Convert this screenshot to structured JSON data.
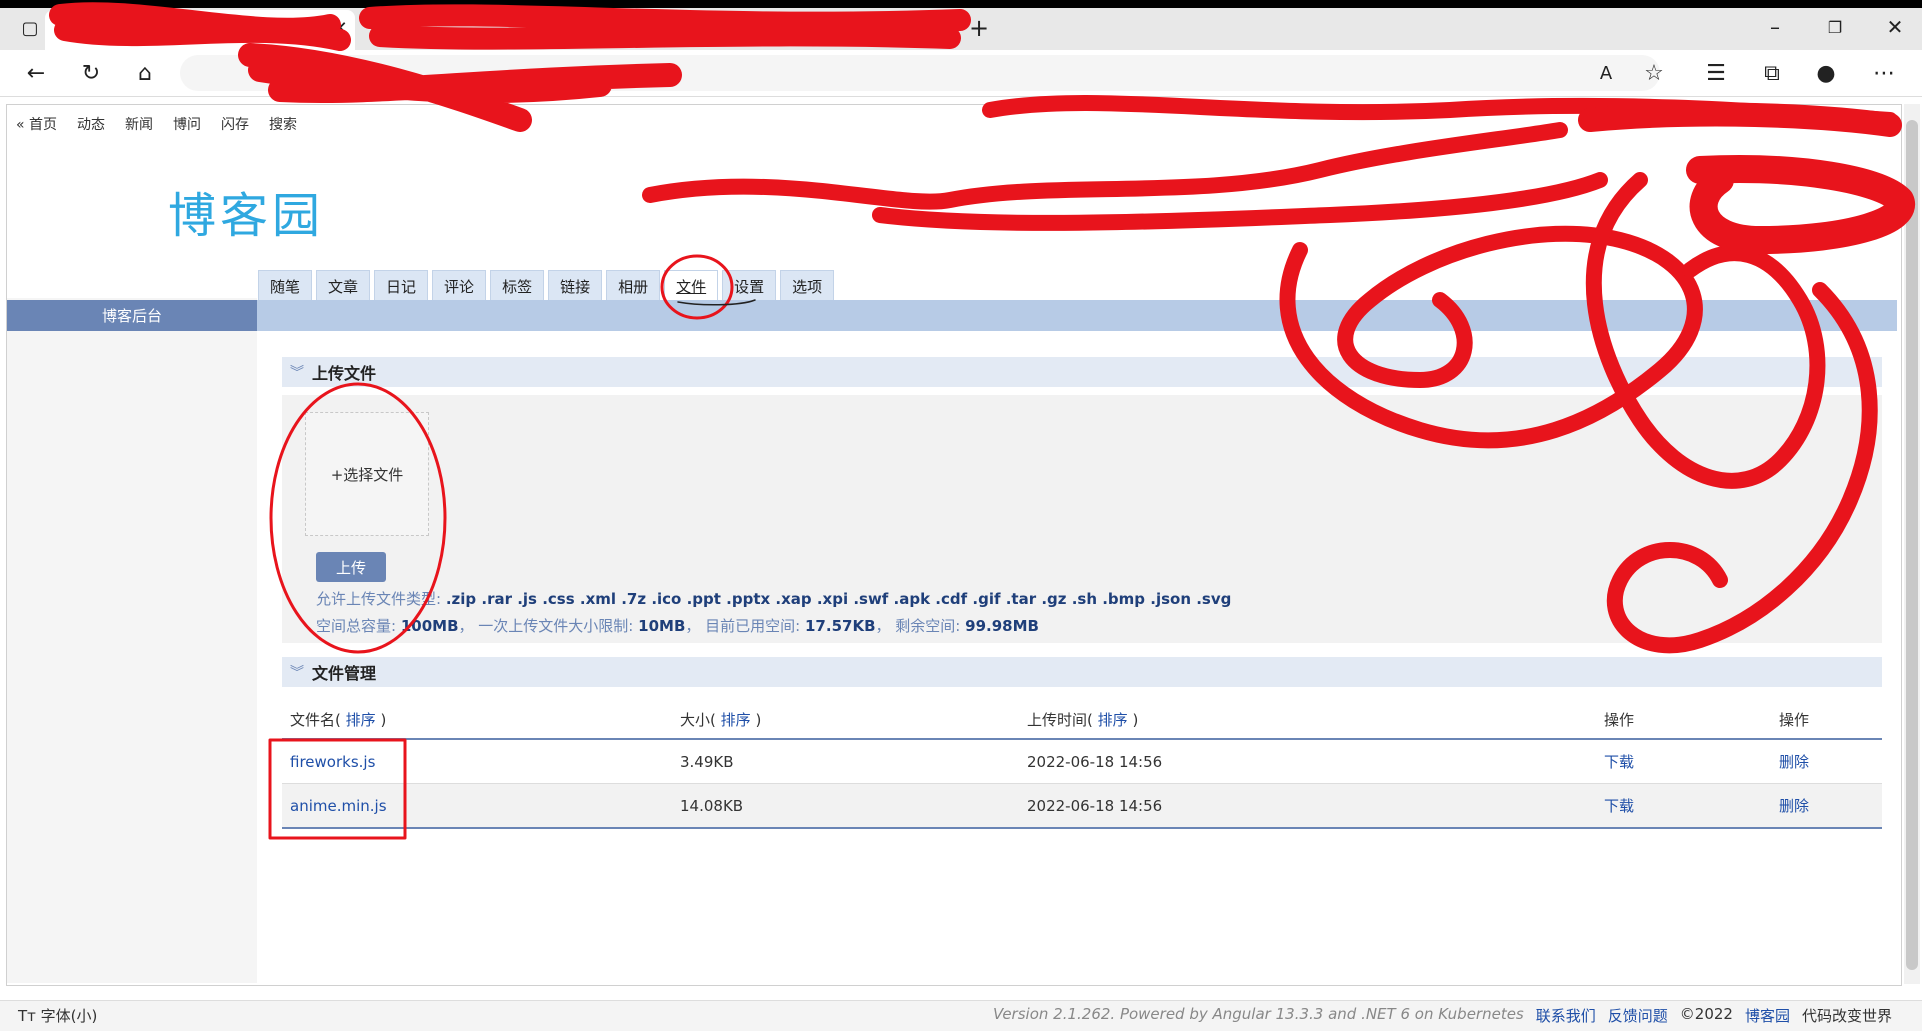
{
  "site_nav": {
    "home": "« 首页",
    "dynamics": "动态",
    "news": "新闻",
    "qa": "博问",
    "flash": "闪存",
    "search": "搜索"
  },
  "logo": {
    "text": "博客园"
  },
  "admin_tabs": [
    "随笔",
    "文章",
    "日记",
    "评论",
    "标签",
    "链接",
    "相册",
    "文件",
    "设置",
    "选项"
  ],
  "active_tab": "文件",
  "sidebar": {
    "title": "博客后台"
  },
  "upload": {
    "section_title": "上传文件",
    "picker_label": "+选择文件",
    "button_label": "上传",
    "allowed_label": "允许上传文件类型:",
    "allowed_types": ".zip .rar .js .css .xml .7z .ico .ppt .pptx .xap .xpi .swf .apk .cdf .gif .tar .gz .sh .bmp .json .svg",
    "total_label": "空间总容量:",
    "total_value": "100MB",
    "single_limit_label": "一次上传文件大小限制:",
    "single_limit_value": "10MB",
    "used_label": "目前已用空间:",
    "used_value": "17.57KB",
    "remain_label": "剩余空间:",
    "remain_value": "99.98MB"
  },
  "files": {
    "section_title": "文件管理",
    "columns": {
      "name": "文件名(",
      "size": "大小(",
      "time": "上传时间(",
      "sort": "排序",
      "close": ")",
      "op1": "操作",
      "op2": "操作"
    },
    "rows": [
      {
        "name": "fireworks.js",
        "size": "3.49KB",
        "time": "2022-06-18 14:56",
        "download": "下载",
        "delete": "删除"
      },
      {
        "name": "anime.min.js",
        "size": "14.08KB",
        "time": "2022-06-18 14:56",
        "download": "下载",
        "delete": "删除"
      }
    ]
  },
  "statusbar": {
    "font_toggle": "Tт 字体(小)",
    "version": "Version 2.1.262. Powered by Angular 13.3.3 and .NET 6 on Kubernetes",
    "contact": "联系我们",
    "feedback": "反馈问题",
    "copyright": "©2022",
    "brand": "博客园",
    "slogan": "代码改变世界"
  },
  "colors": {
    "accent": "#6a85b5",
    "link": "#1f4fa8",
    "logo": "#2fa8e0",
    "annotation": "#e8141c"
  }
}
